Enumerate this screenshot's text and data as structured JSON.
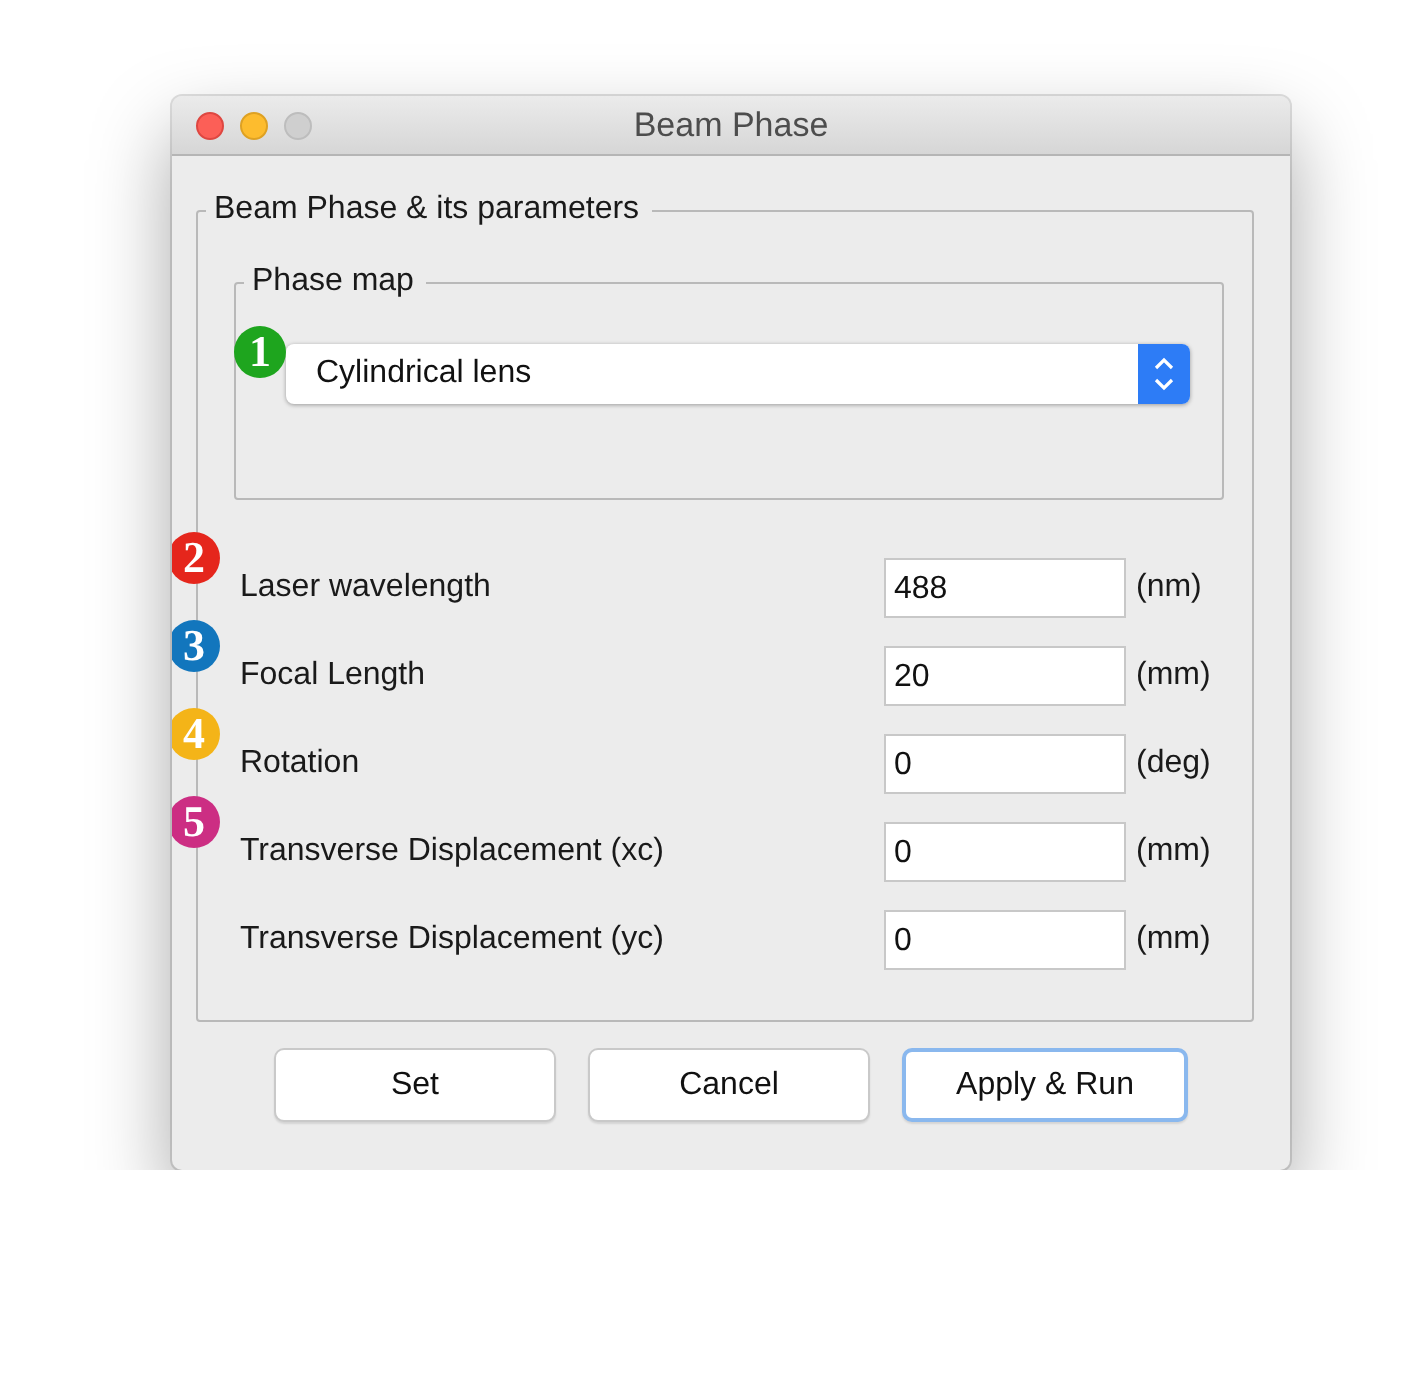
{
  "window": {
    "title": "Beam Phase"
  },
  "panel": {
    "title": "Beam Phase & its parameters"
  },
  "phase_map": {
    "title": "Phase map",
    "badge": {
      "text": "1",
      "color": "#1ea51e"
    },
    "dropdown": {
      "value": "Cylindrical lens"
    }
  },
  "parameters": [
    {
      "label": "Laser wavelength",
      "value": "488",
      "unit": "(nm)",
      "badge": {
        "text": "2",
        "color": "#e5261c"
      }
    },
    {
      "label": "Focal Length",
      "value": "20",
      "unit": "(mm)",
      "badge": {
        "text": "3",
        "color": "#1276bd"
      }
    },
    {
      "label": "Rotation",
      "value": "0",
      "unit": "(deg)",
      "badge": {
        "text": "4",
        "color": "#f4b418"
      }
    },
    {
      "label": "Transverse Displacement (xc)",
      "value": "0",
      "unit": "(mm)",
      "badge": {
        "text": "5",
        "color": "#cc2e83"
      }
    },
    {
      "label": "Transverse Displacement (yc)",
      "value": "0",
      "unit": "(mm)"
    }
  ],
  "buttons": [
    {
      "label": "Set",
      "focused": false
    },
    {
      "label": "Cancel",
      "focused": false
    },
    {
      "label": "Apply & Run",
      "focused": true
    }
  ]
}
